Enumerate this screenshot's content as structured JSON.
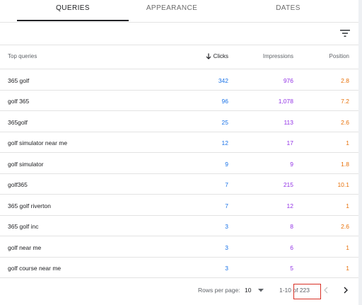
{
  "tabs": [
    {
      "label": "QUERIES",
      "active": true
    },
    {
      "label": "APPEARANCE",
      "active": false
    },
    {
      "label": "DATES",
      "active": false
    }
  ],
  "filter": {
    "icon": "filter-icon"
  },
  "table": {
    "headers": {
      "query": "Top queries",
      "sort_icon": "arrow-down-icon",
      "clicks": "Clicks",
      "impressions": "Impressions",
      "position": "Position"
    },
    "rows": [
      {
        "query": "365 golf",
        "clicks": "342",
        "impressions": "976",
        "position": "2.8"
      },
      {
        "query": "golf 365",
        "clicks": "96",
        "impressions": "1,078",
        "position": "7.2"
      },
      {
        "query": "365golf",
        "clicks": "25",
        "impressions": "113",
        "position": "2.6"
      },
      {
        "query": "golf simulator near me",
        "clicks": "12",
        "impressions": "17",
        "position": "1"
      },
      {
        "query": "golf simulator",
        "clicks": "9",
        "impressions": "9",
        "position": "1.8"
      },
      {
        "query": "golf365",
        "clicks": "7",
        "impressions": "215",
        "position": "10.1"
      },
      {
        "query": "365 golf riverton",
        "clicks": "7",
        "impressions": "12",
        "position": "1"
      },
      {
        "query": "365 golf inc",
        "clicks": "3",
        "impressions": "8",
        "position": "2.6"
      },
      {
        "query": "golf near me",
        "clicks": "3",
        "impressions": "6",
        "position": "1"
      },
      {
        "query": "golf course near me",
        "clicks": "3",
        "impressions": "5",
        "position": "1"
      }
    ]
  },
  "pagination": {
    "rows_per_page_label": "Rows per page:",
    "rows_per_page_value": "10",
    "range": "1-10 of 223",
    "prev_icon": "chevron-left-icon",
    "next_icon": "chevron-right-icon"
  },
  "colors": {
    "clicks": "#1a73e8",
    "impressions": "#9334e6",
    "position": "#e8710a",
    "highlight": "#d93025"
  }
}
